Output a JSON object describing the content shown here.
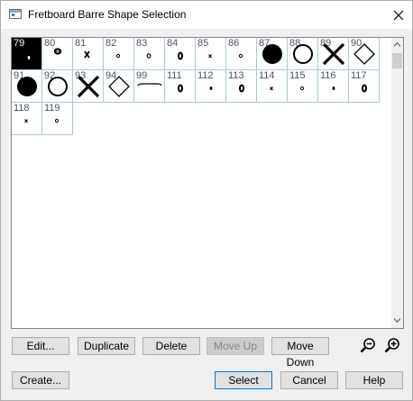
{
  "window": {
    "title": "Fretboard Barre Shape Selection"
  },
  "cells": [
    {
      "num": "79",
      "selected": true,
      "shape": "tiny-dot-white"
    },
    {
      "num": "80",
      "shape": "pill"
    },
    {
      "num": "81",
      "shape": "small-x"
    },
    {
      "num": "82",
      "shape": "tiny-ring"
    },
    {
      "num": "83",
      "shape": "small-ring"
    },
    {
      "num": "84",
      "shape": "oval-ring"
    },
    {
      "num": "85",
      "shape": "tiny-x"
    },
    {
      "num": "86",
      "shape": "tiny-ring"
    },
    {
      "num": "87",
      "shape": "big-dot"
    },
    {
      "num": "88",
      "shape": "big-ring"
    },
    {
      "num": "89",
      "shape": "big-x"
    },
    {
      "num": "90",
      "shape": "diamond"
    },
    {
      "num": "91",
      "shape": "big-dot"
    },
    {
      "num": "92",
      "shape": "big-ring"
    },
    {
      "num": "93",
      "shape": "big-x"
    },
    {
      "num": "94",
      "shape": "diamond"
    },
    {
      "num": "99",
      "shape": "barre-line"
    },
    {
      "num": "111",
      "shape": "oval-ring"
    },
    {
      "num": "112",
      "shape": "small-dot"
    },
    {
      "num": "113",
      "shape": "oval-ring"
    },
    {
      "num": "114",
      "shape": "tiny-x"
    },
    {
      "num": "115",
      "shape": "tiny-ring"
    },
    {
      "num": "116",
      "shape": "small-dot"
    },
    {
      "num": "117",
      "shape": "oval-ring"
    },
    {
      "num": "118",
      "shape": "tiny-x"
    },
    {
      "num": "119",
      "shape": "tiny-ring"
    }
  ],
  "buttons": {
    "edit": "Edit...",
    "duplicate": "Duplicate",
    "delete": "Delete",
    "move_up": "Move Up",
    "move_down": "Move Down",
    "create": "Create...",
    "select": "Select",
    "cancel": "Cancel",
    "help": "Help"
  },
  "icons": {
    "zoom_out": "zoom-out-icon",
    "zoom_in": "zoom-in-icon",
    "close": "close-icon"
  }
}
